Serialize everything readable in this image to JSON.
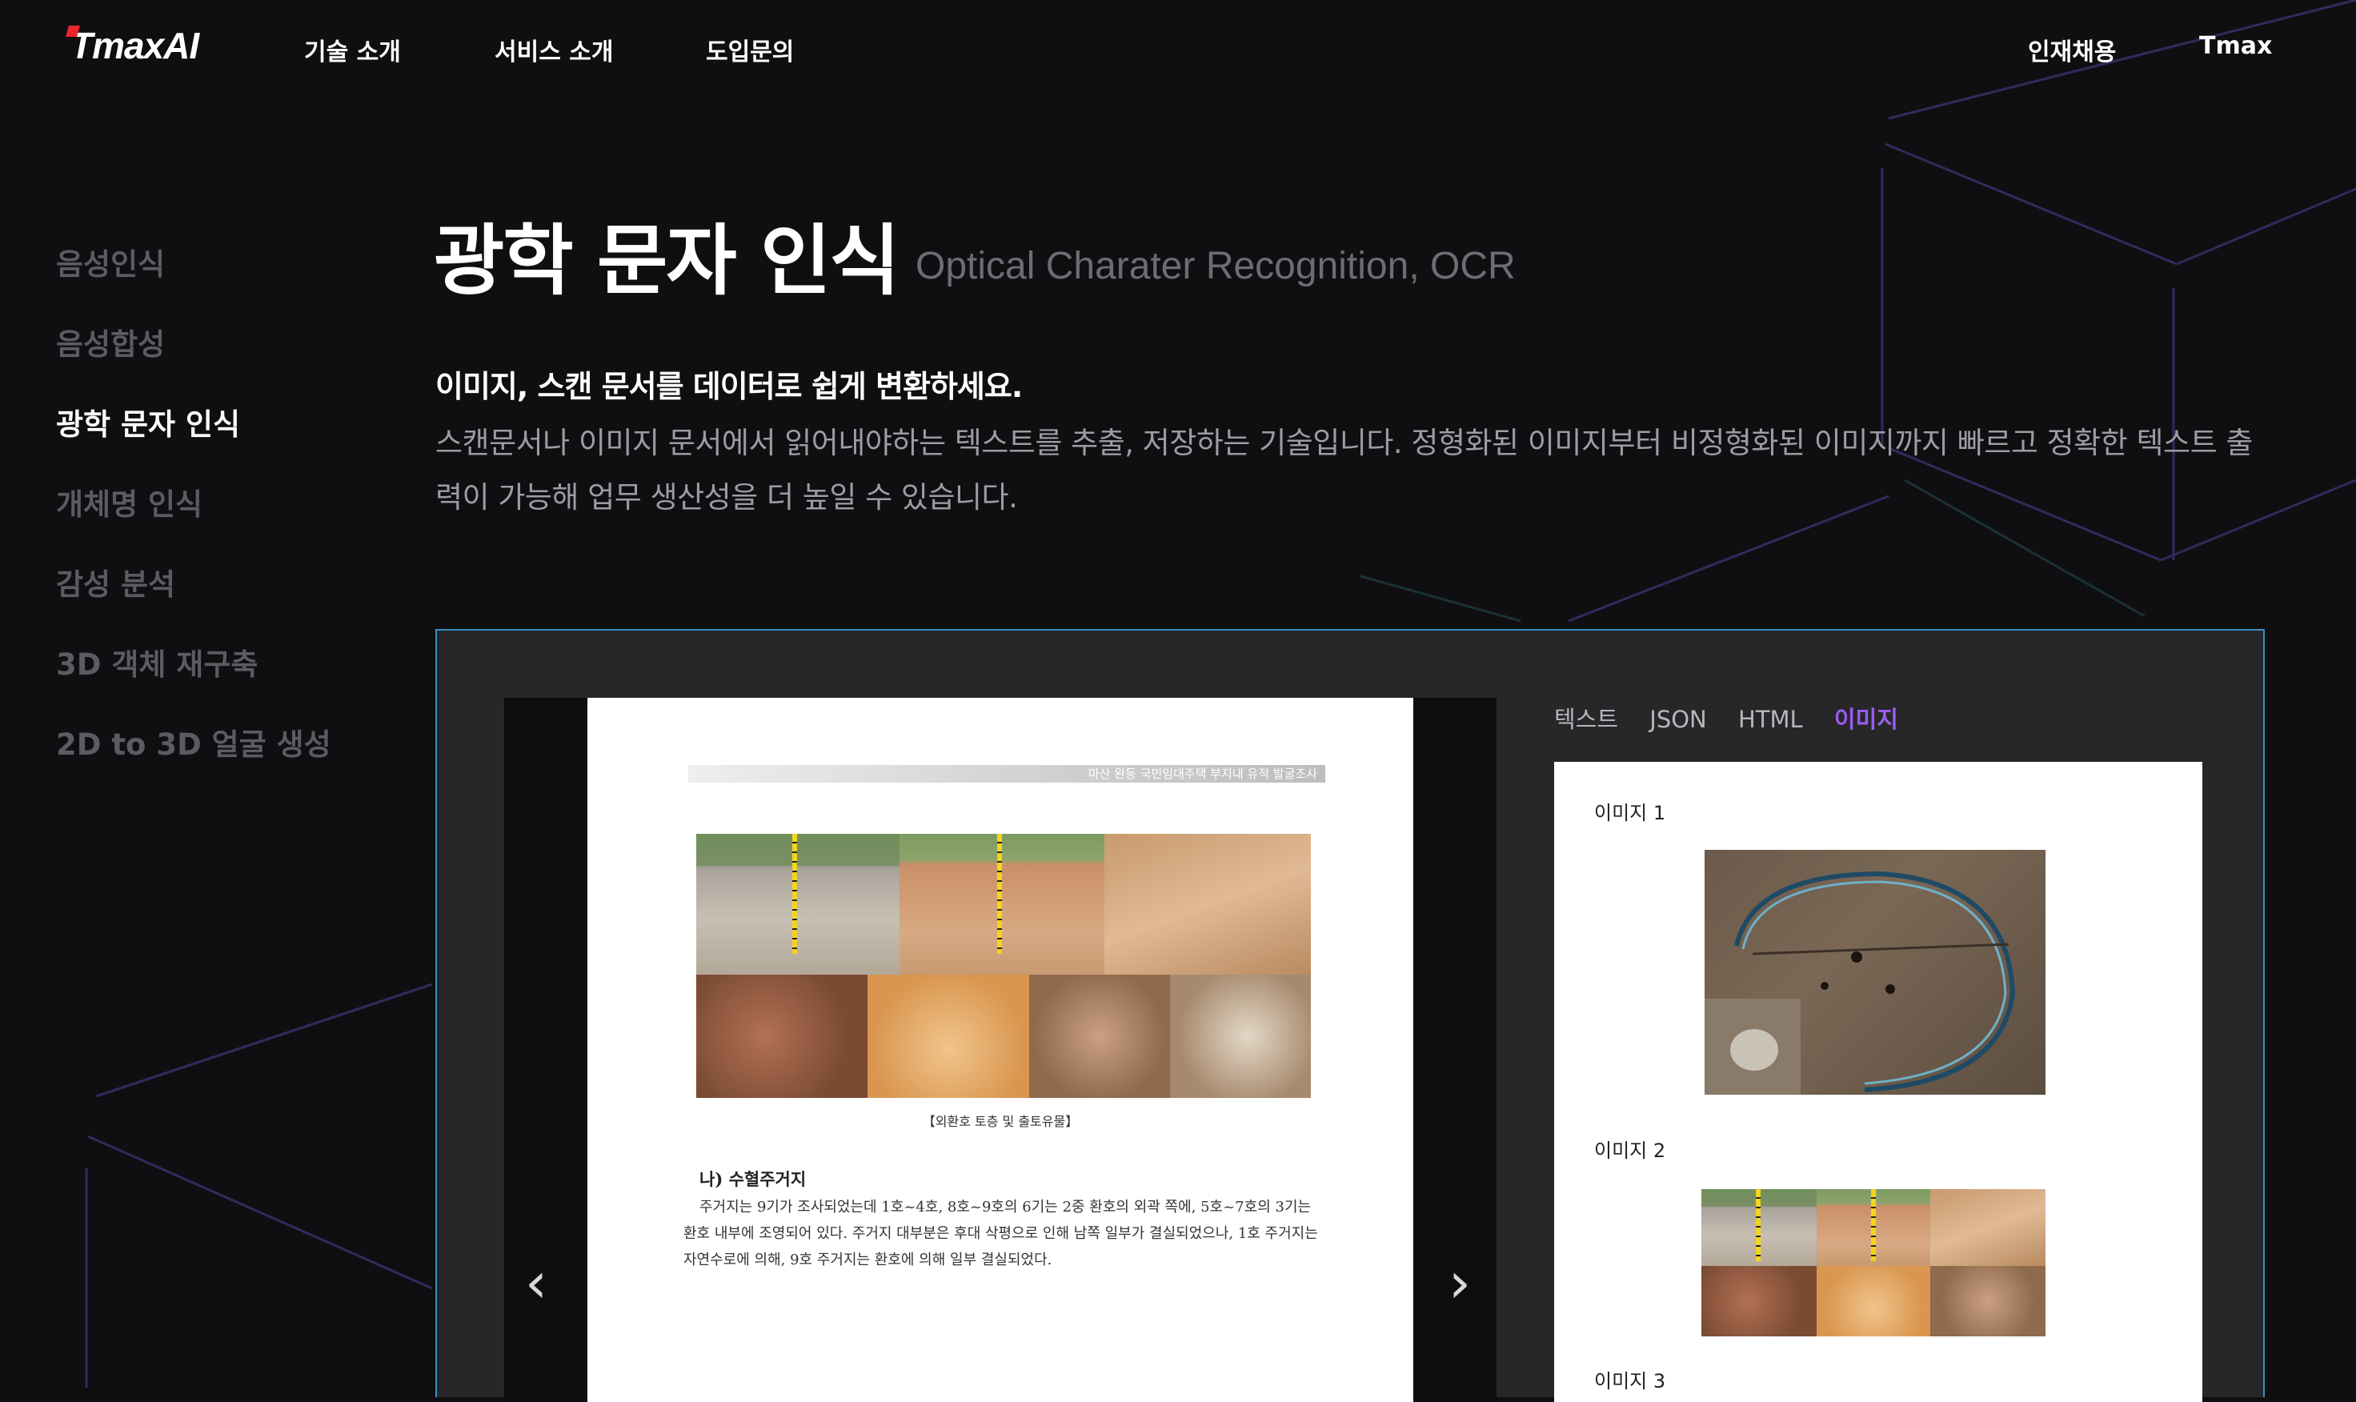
{
  "header": {
    "logo_text": "TmaxAI",
    "nav": [
      "기술 소개",
      "서비스 소개",
      "도입문의"
    ],
    "right_nav": [
      "인재채용",
      "Tmax"
    ]
  },
  "sidebar": {
    "items": [
      {
        "label": "음성인식",
        "active": false
      },
      {
        "label": "음성합성",
        "active": false
      },
      {
        "label": "광학 문자 인식",
        "active": true
      },
      {
        "label": "개체명 인식",
        "active": false
      },
      {
        "label": "감성 분석",
        "active": false
      },
      {
        "label": "3D 객체 재구축",
        "active": false
      },
      {
        "label": "2D to 3D 얼굴 생성",
        "active": false
      }
    ]
  },
  "main": {
    "title": "광학 문자 인식",
    "subtitle": "Optical Charater Recognition, OCR",
    "lead": "이미지, 스캔 문서를 데이터로 쉽게 변환하세요.",
    "description": "스캔문서나 이미지 문서에서 읽어내야하는 텍스트를 추출, 저장하는 기술입니다. 정형화된 이미지부터 비정형화된 이미지까지 빠르고 정확한 텍스트 출력이 가능해 업무 생산성을 더 높일 수 있습니다."
  },
  "demo": {
    "document": {
      "header_text": "마산 완동 국민임대주택 부지내 유적 발굴조사",
      "photo_caption": "【외환호 토층 및 출토유물】",
      "section_heading": "나) 수혈주거지",
      "body": "주거지는 9기가 조사되었는데 1호~4호, 8호~9호의 6기는 2중 환호의 외곽 쪽에, 5호~7호의 3기는 환호 내부에 조영되어 있다. 주거지 대부분은 후대 삭평으로 인해 남쪽 일부가 결실되었으나, 1호 주거지는 자연수로에 의해, 9호 주거지는 환호에 의해 일부 결실되었다."
    },
    "prev_arrow": "‹",
    "next_arrow": "›",
    "result_tabs": [
      {
        "label": "텍스트",
        "active": false
      },
      {
        "label": "JSON",
        "active": false
      },
      {
        "label": "HTML",
        "active": false
      },
      {
        "label": "이미지",
        "active": true
      }
    ],
    "images": [
      "이미지 1",
      "이미지 2",
      "이미지 3"
    ],
    "accent_color": "#9b5cf0",
    "panel_border_color": "#3a8fc0"
  }
}
